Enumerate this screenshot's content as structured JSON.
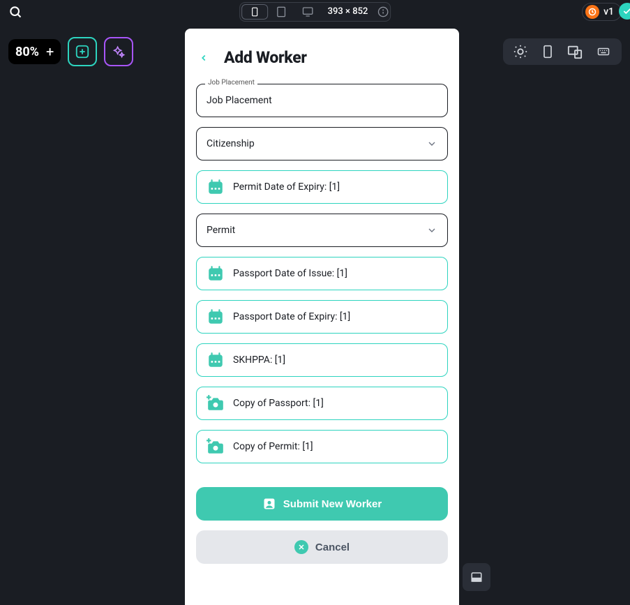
{
  "header": {
    "dimensions": "393 × 852",
    "version_label": "v1"
  },
  "toolbar": {
    "zoom": "80%"
  },
  "sheet": {
    "title": "Add Worker",
    "fields": {
      "job_placement": {
        "legend": "Job Placement",
        "value": "Job Placement"
      },
      "citizenship": {
        "label": "Citizenship"
      },
      "permit_expiry": {
        "label": "Permit Date of Expiry: [1]"
      },
      "permit": {
        "label": "Permit"
      },
      "passport_issue": {
        "label": "Passport Date of Issue: [1]"
      },
      "passport_expiry": {
        "label": "Passport Date of Expiry: [1]"
      },
      "skhppa": {
        "label": "SKHPPA: [1]"
      },
      "copy_passport": {
        "label": "Copy of Passport: [1]"
      },
      "copy_permit": {
        "label": "Copy of Permit: [1]"
      }
    },
    "buttons": {
      "submit": "Submit New Worker",
      "cancel": "Cancel"
    }
  }
}
